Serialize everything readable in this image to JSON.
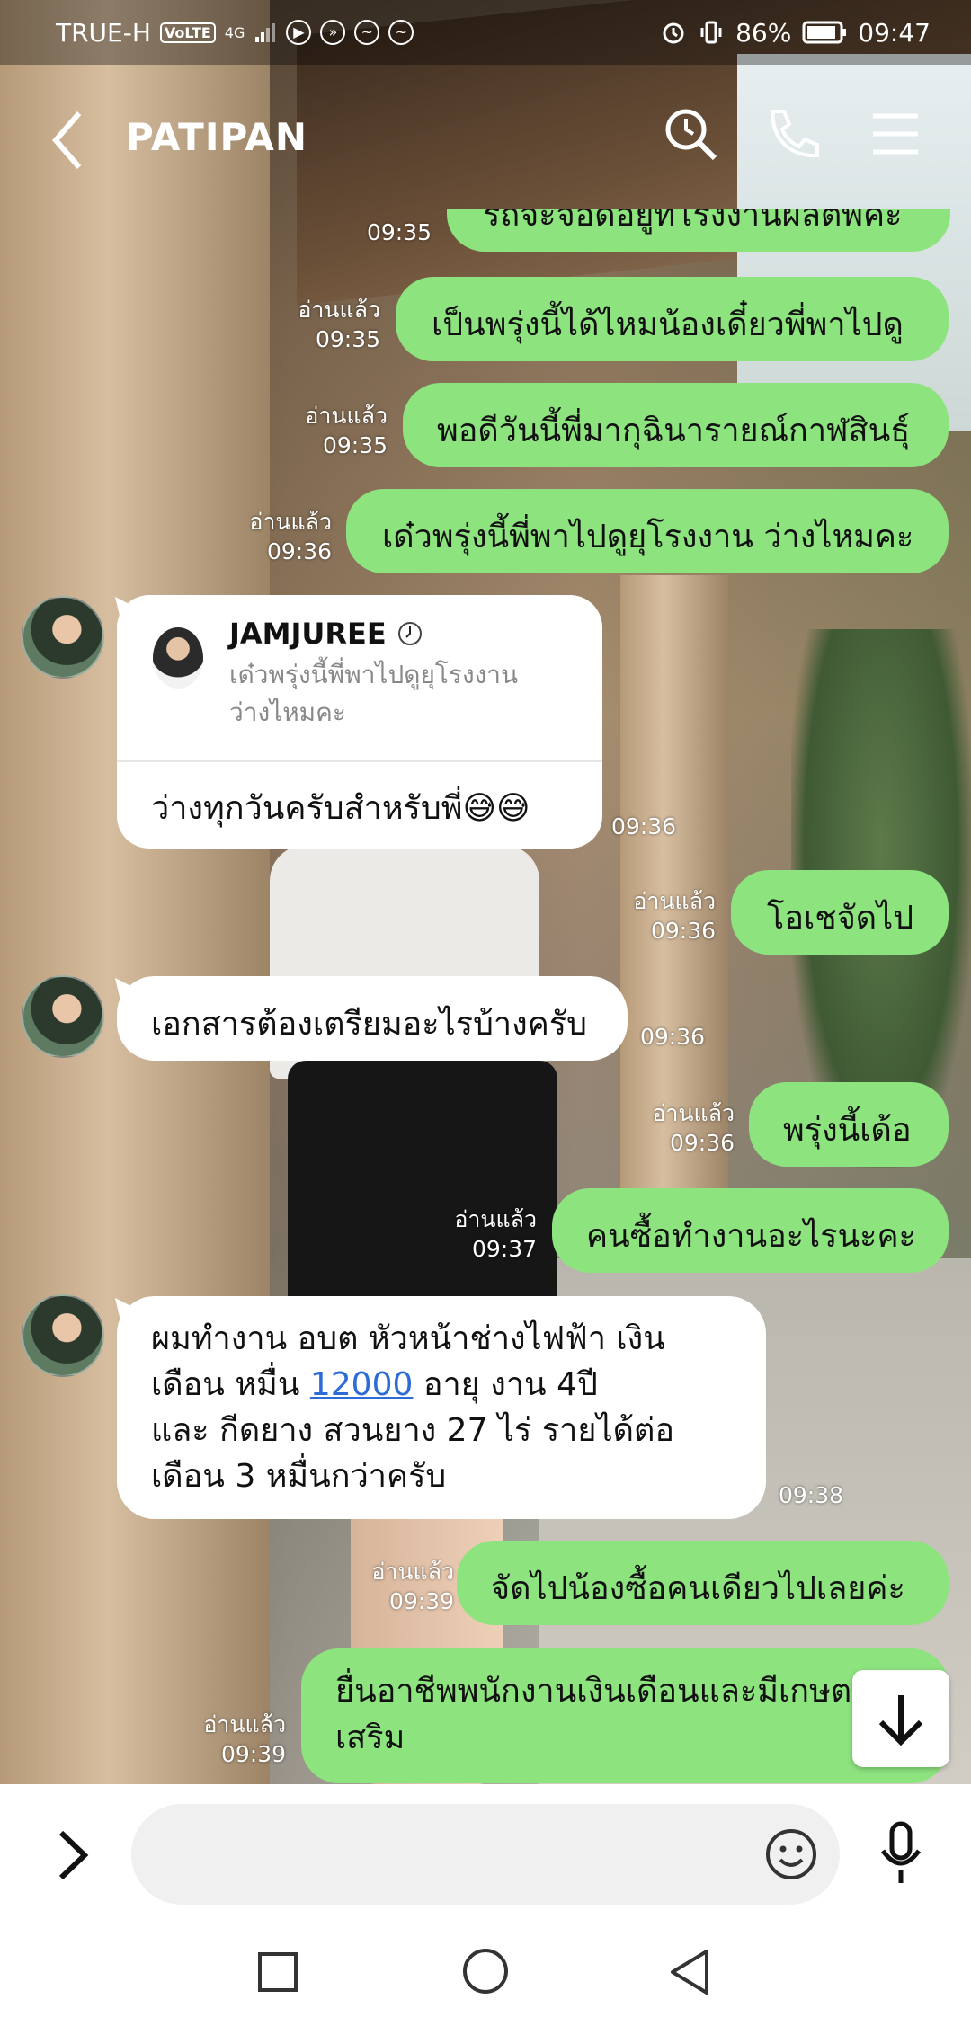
{
  "status_bar": {
    "carrier": "TRUE-H",
    "volte": "VoLTE",
    "network": "4G",
    "battery": "86%",
    "time": "09:47"
  },
  "header": {
    "title": "PATIPAN"
  },
  "messages": {
    "m0": {
      "text": "รถจะจอดอยู่ที่โรงงานผลิตพีคะ",
      "time": "09:35"
    },
    "m1": {
      "text": "เป็นพรุ่งนี้ได้ไหมน้องเดี๋ยวพี่พาไปดู",
      "read": "อ่านแล้ว",
      "time": "09:35"
    },
    "m2": {
      "text": "พอดีวันนี้พี่มากุฉินารายณ์กาฬสินธุ์",
      "read": "อ่านแล้ว",
      "time": "09:35"
    },
    "m3": {
      "text": "เด๋วพรุ่งนี้พี่พาไปดูยุโรงงาน ว่างไหมคะ",
      "read": "อ่านแล้ว",
      "time": "09:36"
    },
    "m4": {
      "reply_name": "JAMJUREE",
      "reply_quote_line1": "เด๋วพรุ่งนี้พี่พาไปดูยุโรงงาน",
      "reply_quote_line2": "ว่างไหมคะ",
      "text": "ว่างทุกวันครับสำหรับพี่😅😅",
      "time": "09:36"
    },
    "m5": {
      "text": "โอเชจัดไป",
      "read": "อ่านแล้ว",
      "time": "09:36"
    },
    "m6": {
      "text": "เอกสารต้องเตรียมอะไรบ้างครับ",
      "time": "09:36"
    },
    "m7": {
      "text": "พรุ่งนี้เด้อ",
      "read": "อ่านแล้ว",
      "time": "09:36"
    },
    "m8": {
      "text": "คนซื้อทำงานอะไรนะคะ",
      "read": "อ่านแล้ว",
      "time": "09:37"
    },
    "m9": {
      "line1": "ผมทำงาน อบต หัวหน้าช่างไฟฟ้า  เงิน",
      "line2_a": "เดือน หมื่น ",
      "line2_link": "12000",
      "line2_b": "  อายุ งาน 4ปี",
      "line3": "และ กีดยาง สวนยาง 27 ไร่ รายได้ต่อ",
      "line4": "เดือน 3 หมื่นกว่าครับ",
      "time": "09:38"
    },
    "m10": {
      "text": "จัดไปน้องซื้อคนเดียวไปเลยค่ะ",
      "read": "อ่านแล้ว",
      "time": "09:39"
    },
    "m11": {
      "line1": "ยื่นอาชีพพนักงานเงินเดือนและมีเกษตร",
      "line2": "เสริม",
      "read": "อ่านแล้ว",
      "time": "09:39"
    }
  },
  "input": {
    "placeholder": ""
  },
  "colors": {
    "outgoing": "#8de37e",
    "incoming": "#ffffff",
    "link": "#2d6bd6"
  }
}
